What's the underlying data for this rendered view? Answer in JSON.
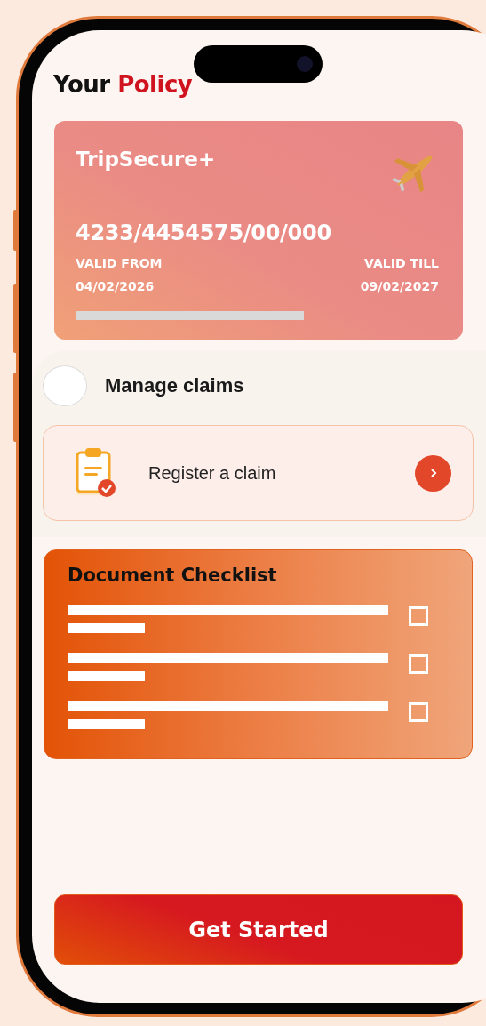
{
  "header": {
    "title": "Your",
    "title_highlight": "Policy"
  },
  "policy_card": {
    "plan": "TripSecure+",
    "number": "4233/4454575/00/000",
    "valid_from_label": "VALID FROM",
    "valid_from": "04/02/2026",
    "valid_till_label": "VALID TILL",
    "valid_till": "09/02/2027"
  },
  "manage_claims": {
    "title": "Manage claims",
    "action": {
      "label": "Register a claim"
    }
  },
  "document_checklist": {
    "title": "Document Checklist",
    "items": [
      {
        "checked": false
      },
      {
        "checked": false
      },
      {
        "checked": false
      }
    ]
  },
  "primary_button": "Get Started"
}
